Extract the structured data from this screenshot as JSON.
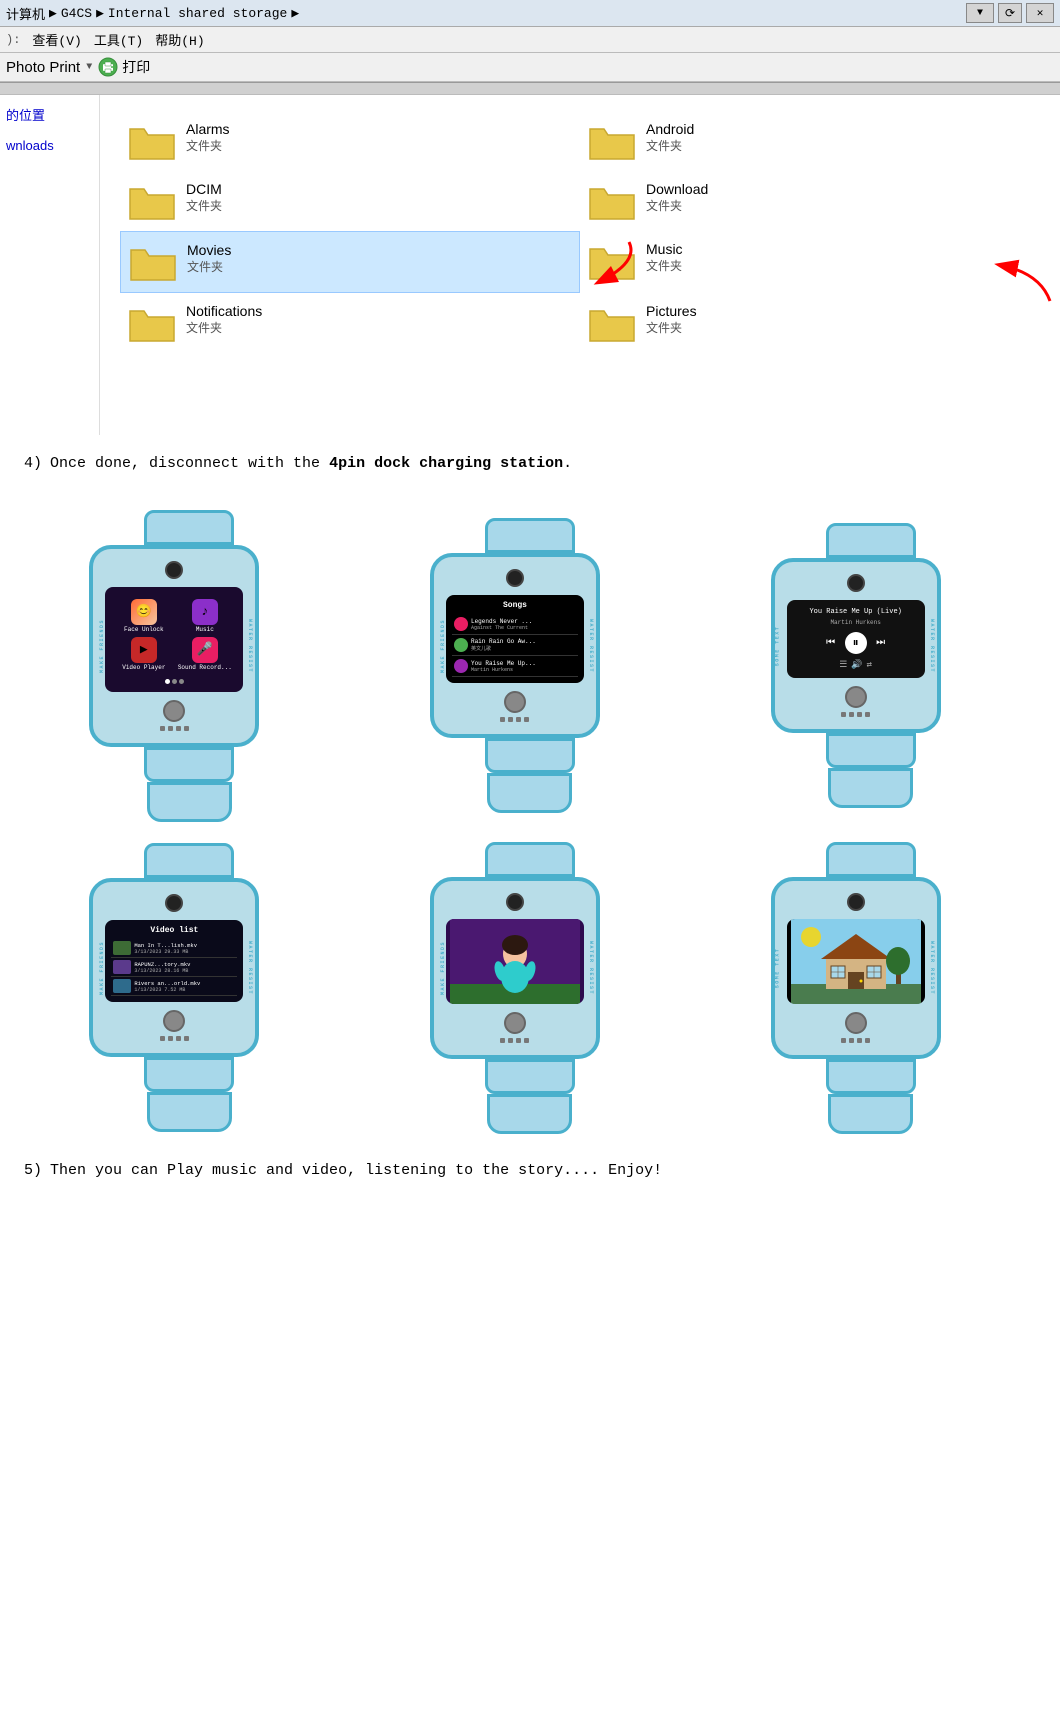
{
  "path_bar": {
    "segments": [
      "计算机",
      "G4CS",
      "Internal shared storage"
    ],
    "arrows": [
      "▶",
      "▶",
      "▶"
    ]
  },
  "menu_bar": {
    "items": [
      "查看(V)",
      "工具(T)",
      "帮助(H)"
    ]
  },
  "toolbar": {
    "photo_print_label": "Photo Print",
    "dropdown_arrow": "▼",
    "print_icon_label": "打印"
  },
  "folders": [
    {
      "name": "Alarms",
      "type": "文件夹",
      "selected": false,
      "arrow": null
    },
    {
      "name": "Android",
      "type": "文件夹",
      "selected": false,
      "arrow": null
    },
    {
      "name": "DCIM",
      "type": "文件夹",
      "selected": false,
      "arrow": null
    },
    {
      "name": "Download",
      "type": "文件夹",
      "selected": false,
      "arrow": null
    },
    {
      "name": "Movies",
      "type": "文件夹",
      "selected": true,
      "arrow": "movies"
    },
    {
      "name": "Music",
      "type": "文件夹",
      "selected": false,
      "arrow": "music"
    },
    {
      "name": "Notifications",
      "type": "文件夹",
      "selected": false,
      "arrow": null
    },
    {
      "name": "Pictures",
      "type": "文件夹",
      "selected": false,
      "arrow": null
    }
  ],
  "left_panel": {
    "items": [
      "的位置",
      "wnloads"
    ]
  },
  "step4": {
    "number": "4)",
    "text": "Once done, disconnect with the ",
    "bold": "4pin dock charging station",
    "period": "."
  },
  "watches_row1": [
    {
      "id": "watch-1",
      "screen_type": "app_grid",
      "apps": [
        {
          "label": "Face Unlock",
          "color": "#ff6b35",
          "icon": "😊"
        },
        {
          "label": "Music",
          "color": "#8b2fc9",
          "icon": "♪"
        },
        {
          "label": "Video Player",
          "color": "#e74c3c",
          "icon": "▶"
        },
        {
          "label": "Sound Record...",
          "color": "#e91e63",
          "icon": "🎤"
        }
      ]
    },
    {
      "id": "watch-2",
      "screen_type": "song_list",
      "header": "Songs",
      "songs": [
        {
          "title": "Legends Never ...",
          "artist": "Against The Current",
          "color": "#e91e63"
        },
        {
          "title": "Rain Rain Go Aw...",
          "artist": "英文儿歌",
          "color": "#4caf50"
        },
        {
          "title": "You Raise Me Up...",
          "artist": "Martin Hurkens",
          "color": "#9c27b0"
        }
      ]
    },
    {
      "id": "watch-3",
      "screen_type": "player",
      "now_playing": "You Raise Me Up (Live)",
      "artist": "Martin Hurkens"
    }
  ],
  "watches_row2": [
    {
      "id": "watch-4",
      "screen_type": "video_list",
      "header": "Video list",
      "videos": [
        {
          "title": "Man In T...lish.mkv",
          "meta": "3/13/2023 29.33 MB"
        },
        {
          "title": "RAPUNZ...tory.mkv",
          "meta": "3/13/2023 28.16 MB"
        },
        {
          "title": "Rivers an...orld.mkv",
          "meta": "1/13/2023 7.52 MB"
        }
      ]
    },
    {
      "id": "watch-5",
      "screen_type": "animation",
      "description": "Animated character"
    },
    {
      "id": "watch-6",
      "screen_type": "video_playback",
      "description": "Video playing - house scene"
    }
  ],
  "step5": {
    "number": "5)",
    "text": "Then you can Play music and video, listening to the story....  Enjoy!"
  },
  "side_text": {
    "left": "MAKE FRIENDS",
    "right": "WATER RESIST"
  }
}
